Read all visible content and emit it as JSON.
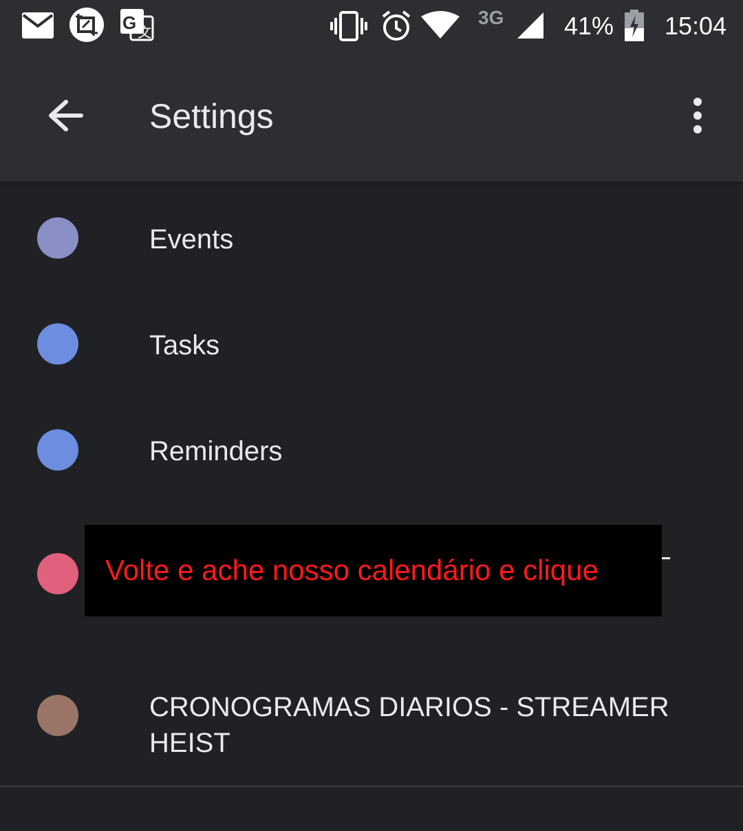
{
  "status_bar": {
    "network": "3G",
    "battery": "41%",
    "time": "15:04",
    "icons": [
      "mail-icon",
      "screenshot-icon",
      "translate-icon",
      "vibrate-icon",
      "alarm-icon",
      "wifi-icon",
      "signal-icon",
      "battery-charging-icon"
    ]
  },
  "app_bar": {
    "title": "Settings",
    "back_icon": "arrow-back-icon",
    "menu_icon": "more-vert-icon"
  },
  "calendars": [
    {
      "label": "Events",
      "color": "#8a8fc6"
    },
    {
      "label": "Tasks",
      "color": "#6c8de0"
    },
    {
      "label": "Reminders",
      "color": "#6c8de0"
    },
    {
      "label": "",
      "color": "#e0607e"
    },
    {
      "label": "CRONOGRAMAS DIARIOS - STREAMER HEIST",
      "color": "#9a7568"
    }
  ],
  "overlay": {
    "text": "Volte e ache nosso calendário e clique",
    "text_color": "#ff1a1a",
    "background": "#000000"
  },
  "colors": {
    "background": "#202124",
    "bar": "#2d2e31"
  }
}
